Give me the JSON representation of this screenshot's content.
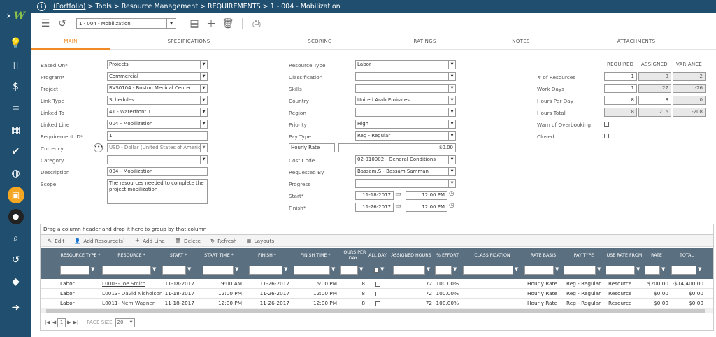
{
  "topbar": {
    "portfolio": "(Portfolio)",
    "crumb": "> Tools > Resource Management > REQUIREMENTS > 1 - 004 - Mobilization"
  },
  "toolbar": {
    "record_select": "1 - 004 - Mobilization"
  },
  "tabs": [
    "MAIN",
    "SPECIFICATIONS",
    "SCORING",
    "RATINGS",
    "NOTES",
    "ATTACHMENTS"
  ],
  "form_left": {
    "based_on_label": "Based On*",
    "based_on": "Projects",
    "program_label": "Program*",
    "program": "Commercial",
    "project_label": "Project",
    "project": "RVS0104 - Boston Medical Center",
    "link_type_label": "Link Type",
    "link_type": "Schedules",
    "linked_to_label": "Linked To",
    "linked_to": "41 - Waterfront 1",
    "linked_line_label": "Linked Line",
    "linked_line": "004 - Mobilization",
    "req_id_label": "Requirement ID*",
    "req_id": "1",
    "currency_label": "Currency",
    "currency": "USD - Dollar (United States of Americ",
    "category_label": "Category",
    "category": "",
    "description_label": "Description",
    "description": "004 - Mobilization",
    "scope_label": "Scope",
    "scope": "The resources needed to complete the project mobilization"
  },
  "form_mid": {
    "resource_type_label": "Resource Type",
    "resource_type": "Labor",
    "classification_label": "Classification",
    "classification": "",
    "skills_label": "Skills",
    "skills": "",
    "country_label": "Country",
    "country": "United Arab Emirates",
    "region_label": "Region",
    "region": "",
    "priority_label": "Priority",
    "priority": "High",
    "pay_type_label": "Pay Type",
    "pay_type": "Reg - Regular",
    "rate_basis": "Hourly Rate",
    "rate_value": "$0.00",
    "cost_code_label": "Cost Code",
    "cost_code": "02-010002 - General Conditions",
    "requested_by_label": "Requested By",
    "requested_by": "Bassam.S - Bassam Samman",
    "progress_label": "Progress",
    "progress": "",
    "start_label": "Start*",
    "start_date": "11-18-2017",
    "start_time": "12:00 PM",
    "finish_label": "Finish*",
    "finish_date": "11-26-2017",
    "finish_time": "12:00 PM"
  },
  "form_right": {
    "headers": [
      "REQUIRED",
      "ASSIGNED",
      "VARIANCE"
    ],
    "rows": [
      {
        "label": "# of Resources",
        "required": "1",
        "assigned": "3",
        "variance": "-2"
      },
      {
        "label": "Work Days",
        "required": "1",
        "assigned": "27",
        "variance": "-26"
      },
      {
        "label": "Hours Per Day",
        "required": "8",
        "assigned": "8",
        "variance": "0"
      },
      {
        "label": "Hours Total",
        "required": "8",
        "assigned": "216",
        "variance": "-208"
      }
    ],
    "warn_label": "Warn of Overbooking",
    "closed_label": "Closed"
  },
  "grid": {
    "group_hint": "Drag a column header and drop it here to group by that column",
    "toolbar": [
      "Edit",
      "Add Resource(s)",
      "Add Line",
      "Delete",
      "Refresh",
      "Layouts"
    ],
    "columns": [
      "RESOURCE TYPE *",
      "RESOURCE *",
      "START *",
      "START TIME *",
      "FINISH *",
      "FINISH TIME *",
      "HOURS PER DAY",
      "ALL DAY",
      "ASSIGNED HOURS",
      "% EFFORT",
      "CLASSIFICATION",
      "RATE BASIS",
      "PAY TYPE",
      "USE RATE FROM",
      "RATE",
      "TOTAL"
    ],
    "rows": [
      {
        "type": "Labor",
        "resource": "L0003- Joe Smith",
        "start": "11-18-2017",
        "start_time": "9:00 AM",
        "finish": "11-26-2017",
        "finish_time": "5:00 PM",
        "hpd": "8",
        "hours": "72",
        "effort": "100.00%",
        "classification": "",
        "rate_basis": "Hourly Rate",
        "pay_type": "Reg - Regular",
        "use_rate": "Resource",
        "rate": "$200.00",
        "total": "-$14,400.00"
      },
      {
        "type": "Labor",
        "resource": "L0013- David Nicholson",
        "start": "11-18-2017",
        "start_time": "12:00 PM",
        "finish": "11-26-2017",
        "finish_time": "12:00 PM",
        "hpd": "8",
        "hours": "72",
        "effort": "100.00%",
        "classification": "",
        "rate_basis": "Hourly Rate",
        "pay_type": "Reg - Regular",
        "use_rate": "Resource",
        "rate": "$0.00",
        "total": "$0.00"
      },
      {
        "type": "Labor",
        "resource": "L0011- Nem Wagner",
        "start": "11-18-2017",
        "start_time": "12:00 PM",
        "finish": "11-26-2017",
        "finish_time": "12:00 PM",
        "hpd": "8",
        "hours": "72",
        "effort": "100.00%",
        "classification": "",
        "rate_basis": "Hourly Rate",
        "pay_type": "Reg - Regular",
        "use_rate": "Resource",
        "rate": "$0.00",
        "total": "$0.00"
      }
    ],
    "pager": {
      "page": "1",
      "page_size_label": "PAGE SIZE",
      "page_size": "20"
    }
  }
}
